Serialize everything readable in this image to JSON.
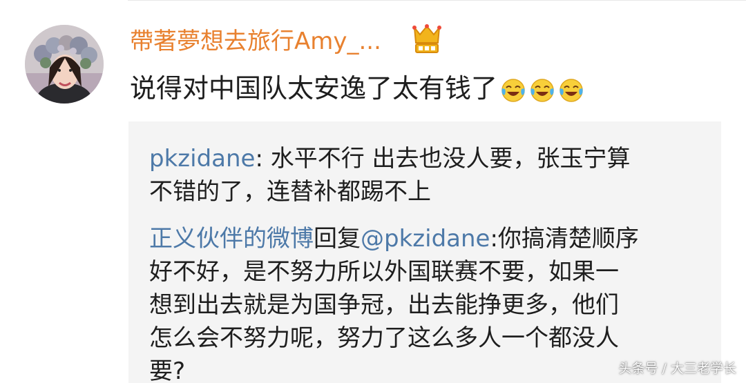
{
  "comment": {
    "username": "帶著夢想去旅行Amy_...",
    "text": "说得对中国队太安逸了太有钱了",
    "emojis": [
      "laugh-cry-emoji",
      "laugh-cry-emoji",
      "laugh-cry-emoji"
    ],
    "badge_icon": "crown-vip-icon"
  },
  "replies": [
    {
      "user": "pkzidane",
      "separator": ": ",
      "text_line1": "水平不行 出去也没人要，张玉宁算",
      "text_line2": "不错的了，连替补都踢不上"
    },
    {
      "user": "正义伙伴的微博",
      "reply_word": "回复",
      "mention": "@pkzidane",
      "separator": ":",
      "text_line1": "你搞清楚顺序",
      "text_line2": "好不好，是不努力所以外国联赛不要，如果一",
      "text_line3": "想到出去就是为国争冠，出去能挣更多，他们",
      "text_line4": "怎么会不努力呢，努力了这么多人一个都没人",
      "text_line5": "要?"
    }
  ],
  "watermark": "头条号 / 大三老学长",
  "colors": {
    "username": "#e8812f",
    "reply_user": "#4d79a8",
    "reply_bg": "#f4f4f4"
  }
}
